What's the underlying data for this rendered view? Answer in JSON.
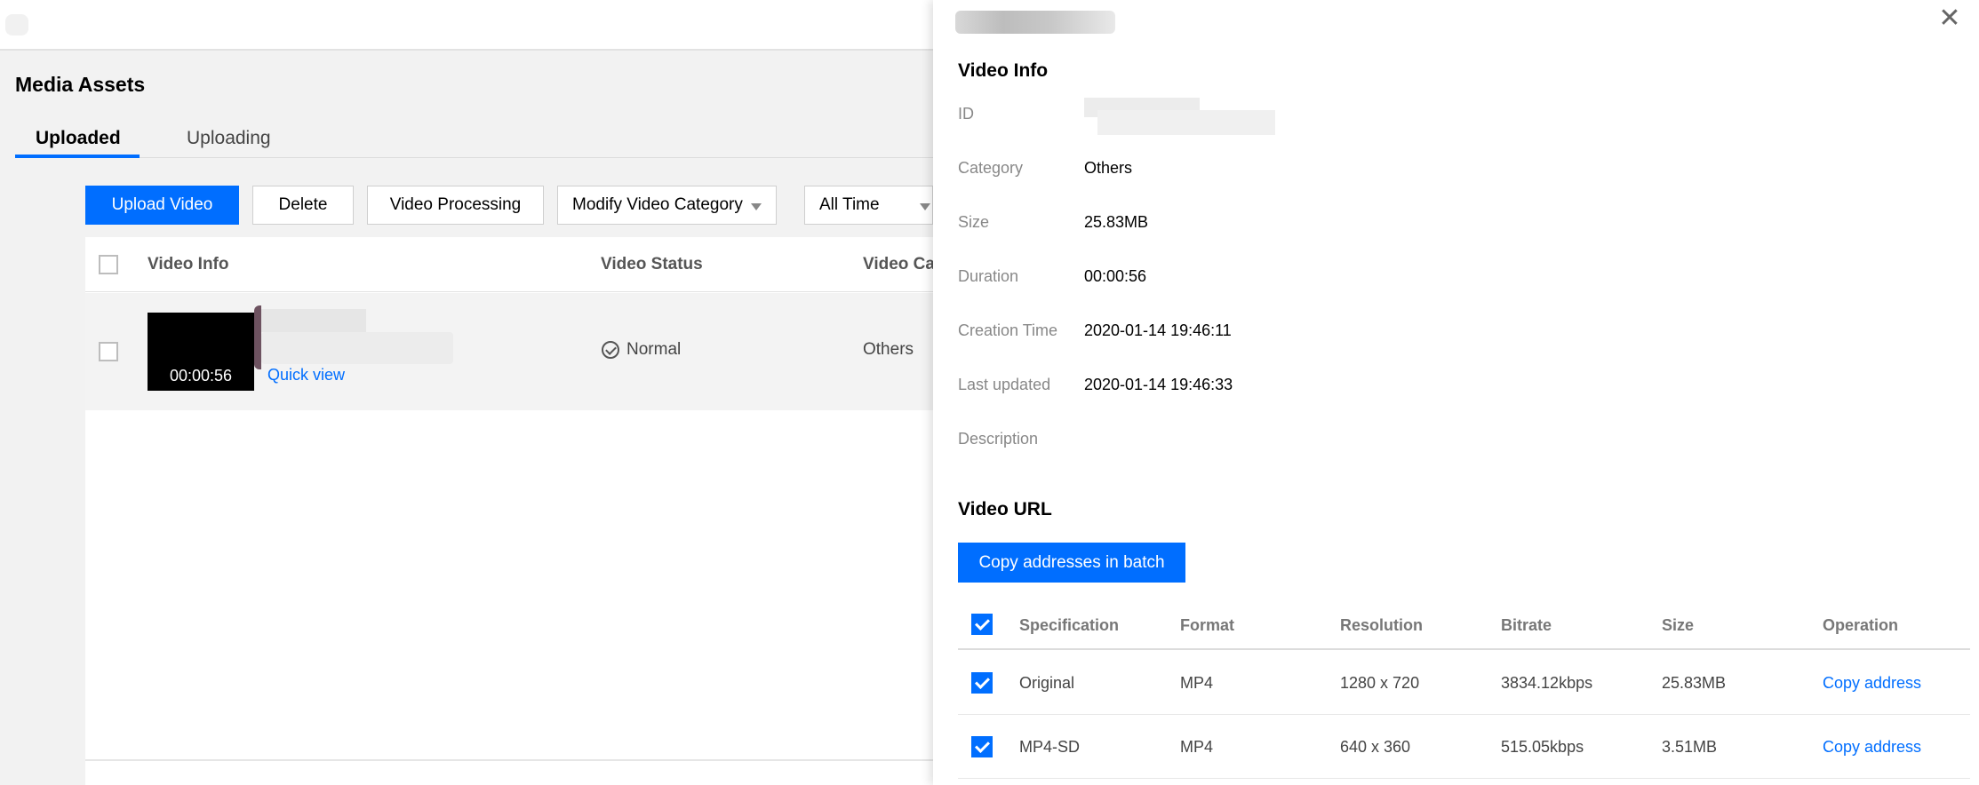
{
  "page": {
    "title": "Media Assets",
    "tabs": [
      {
        "label": "Uploaded",
        "active": true
      },
      {
        "label": "Uploading",
        "active": false
      }
    ]
  },
  "toolbar": {
    "upload_label": "Upload Video",
    "delete_label": "Delete",
    "processing_label": "Video Processing",
    "category_label": "Modify Video Category",
    "time_label": "All Time"
  },
  "table": {
    "headers": [
      "Video Info",
      "Video Status",
      "Video Ca"
    ],
    "rows": [
      {
        "duration": "00:00:56",
        "quick_view": "Quick view",
        "status": "Normal",
        "category": "Others"
      }
    ]
  },
  "drawer": {
    "video_info_title": "Video Info",
    "fields": [
      {
        "label": "ID",
        "value": ""
      },
      {
        "label": "Category",
        "value": "Others"
      },
      {
        "label": "Size",
        "value": "25.83MB"
      },
      {
        "label": "Duration",
        "value": "00:00:56"
      },
      {
        "label": "Creation Time",
        "value": "2020-01-14 19:46:11"
      },
      {
        "label": "Last updated",
        "value": "2020-01-14 19:46:33"
      },
      {
        "label": "Description",
        "value": ""
      }
    ],
    "video_url_title": "Video URL",
    "copy_batch_label": "Copy addresses in batch",
    "url_table": {
      "headers": [
        "Specification",
        "Format",
        "Resolution",
        "Bitrate",
        "Size",
        "Operation"
      ],
      "rows": [
        {
          "spec": "Original",
          "format": "MP4",
          "resolution": "1280 x 720",
          "bitrate": "3834.12kbps",
          "size": "25.83MB",
          "operation": "Copy address"
        },
        {
          "spec": "MP4-SD",
          "format": "MP4",
          "resolution": "640 x 360",
          "bitrate": "515.05kbps",
          "size": "3.51MB",
          "operation": "Copy address"
        }
      ]
    }
  },
  "colors": {
    "accent": "#006eff",
    "background": "#f2f2f2"
  }
}
